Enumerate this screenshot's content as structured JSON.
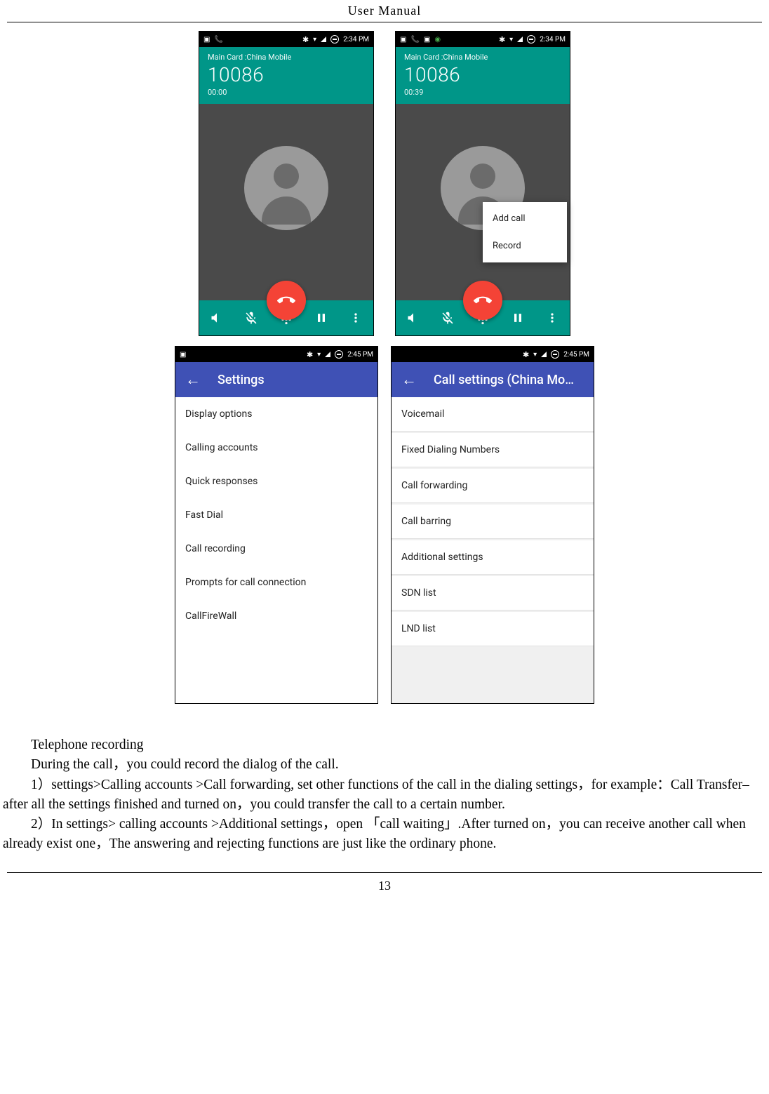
{
  "header": {
    "title": "User  Manual"
  },
  "footer": {
    "page": "13"
  },
  "call_a": {
    "time": "2:34 PM",
    "carrier": "Main Card :China Mobile",
    "number": "10086",
    "timer": "00:00"
  },
  "call_b": {
    "time": "2:34 PM",
    "carrier": "Main Card :China Mobile",
    "number": "10086",
    "timer": "00:39",
    "menu": {
      "add": "Add call",
      "record": "Record"
    }
  },
  "settings_a": {
    "time": "2:45 PM",
    "title": "Settings",
    "items": [
      "Display options",
      "Calling accounts",
      "Quick responses",
      "Fast Dial",
      "Call recording",
      "Prompts for call connection",
      "CallFireWall"
    ]
  },
  "settings_b": {
    "time": "2:45 PM",
    "title": "Call settings (China Mo…",
    "items": [
      "Voicemail",
      "Fixed Dialing Numbers",
      "Call forwarding",
      "Call barring",
      "Additional settings",
      "SDN list",
      "LND list"
    ]
  },
  "body": {
    "h": "Telephone recording",
    "p1": "During the call，you could record the dialog of the call.",
    "p2": "1）settings>Calling accounts >Call forwarding, set other functions of the call in the dialing settings，for example：Call Transfer– after all the settings finished and turned on，you could transfer the call to a certain number.",
    "p3": "2）In settings> calling accounts >Additional settings，open 「call waiting」.After turned on，you can receive another call when already exist one，The answering and rejecting functions are just like the ordinary phone."
  }
}
